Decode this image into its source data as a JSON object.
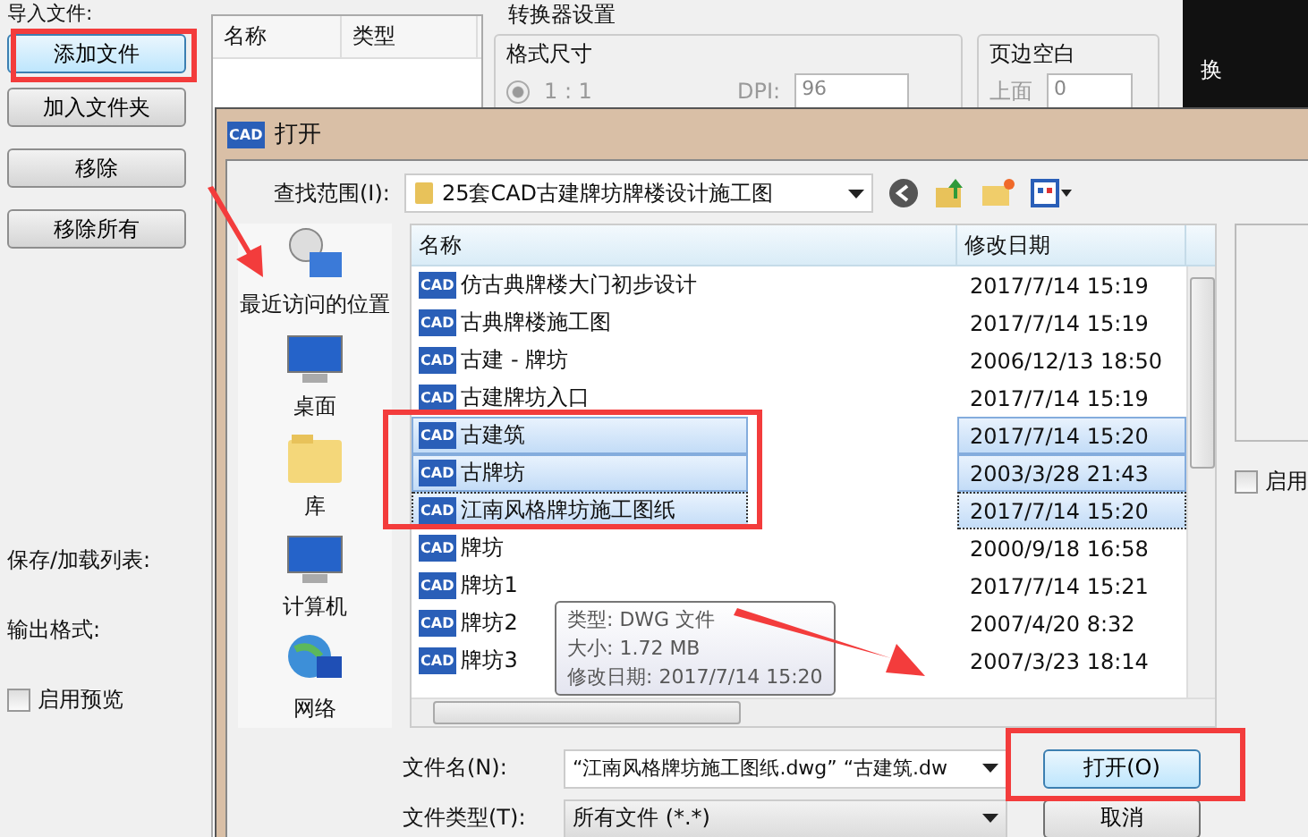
{
  "app": {
    "import_label": "导入文件:",
    "buttons": [
      {
        "label": "添加文件",
        "highlighted": true
      },
      {
        "label": "加入文件夹",
        "highlighted": false
      },
      {
        "label": "移除",
        "highlighted": false
      },
      {
        "label": "移除所有",
        "highlighted": false
      }
    ],
    "list_columns": [
      "名称",
      "类型"
    ],
    "save_load_label": "保存/加载列表:",
    "output_format_label": "输出格式:",
    "preview": {
      "label": "启用预览",
      "checked": false
    },
    "converter": {
      "title": "转换器设置",
      "format_group": "格式尺寸",
      "ratio": {
        "label": "1 : 1",
        "selected": true
      },
      "dpi_label": "DPI:",
      "dpi_value": "96",
      "margin_group": "页边空白",
      "top_label": "上面",
      "top_value": "0"
    },
    "dark_strip_text": "换"
  },
  "dialog": {
    "title": "打开",
    "app_badge": "CAD",
    "look_in_label": "查找范围(I):",
    "look_in_value": "25套CAD古建牌坊牌楼设计施工图",
    "places": [
      {
        "label": "最近访问的位置",
        "kind": "recent"
      },
      {
        "label": "桌面",
        "kind": "desktop"
      },
      {
        "label": "库",
        "kind": "library"
      },
      {
        "label": "计算机",
        "kind": "computer"
      },
      {
        "label": "网络",
        "kind": "network"
      }
    ],
    "columns": [
      "名称",
      "修改日期"
    ],
    "files": [
      {
        "badge": "CAD",
        "name": "仿古典牌楼大门初步设计",
        "date": "2017/7/14 15:19",
        "selected": false,
        "focused": false
      },
      {
        "badge": "CAD",
        "name": "古典牌楼施工图",
        "date": "2017/7/14 15:19",
        "selected": false,
        "focused": false
      },
      {
        "badge": "CAD",
        "name": "古建 - 牌坊",
        "date": "2006/12/13 18:50",
        "selected": false,
        "focused": false
      },
      {
        "badge": "CAD",
        "name": "古建牌坊入口",
        "date": "2017/7/14 15:19",
        "selected": false,
        "focused": false
      },
      {
        "badge": "CAD",
        "name": "古建筑",
        "date": "2017/7/14 15:20",
        "selected": true,
        "focused": false
      },
      {
        "badge": "CAD",
        "name": "古牌坊",
        "date": "2003/3/28 21:43",
        "selected": true,
        "focused": false
      },
      {
        "badge": "CAD",
        "name": "江南风格牌坊施工图纸",
        "date": "2017/7/14 15:20",
        "selected": true,
        "focused": true
      },
      {
        "badge": "CAD",
        "name": "牌坊",
        "date": "2000/9/18 16:58",
        "selected": false,
        "focused": false
      },
      {
        "badge": "CAD",
        "name": "牌坊1",
        "date": "2017/7/14 15:21",
        "selected": false,
        "focused": false
      },
      {
        "badge": "CAD",
        "name": "牌坊2",
        "date": "2007/4/20 8:32",
        "selected": false,
        "focused": false
      },
      {
        "badge": "CAD",
        "name": "牌坊3",
        "date": "2007/3/23 18:14",
        "selected": false,
        "focused": false
      }
    ],
    "tooltip": [
      "类型: DWG 文件",
      "大小: 1.72 MB",
      "修改日期: 2017/7/14 15:20"
    ],
    "preview_checkbox": {
      "label": "启用",
      "checked": false
    },
    "filename_label": "文件名(N):",
    "filename_value": "“江南风格牌坊施工图纸.dwg” “古建筑.dw",
    "filetype_label": "文件类型(T):",
    "filetype_value": "所有文件 (*.*)",
    "open_button": "打开(O)",
    "cancel_button": "取消"
  }
}
